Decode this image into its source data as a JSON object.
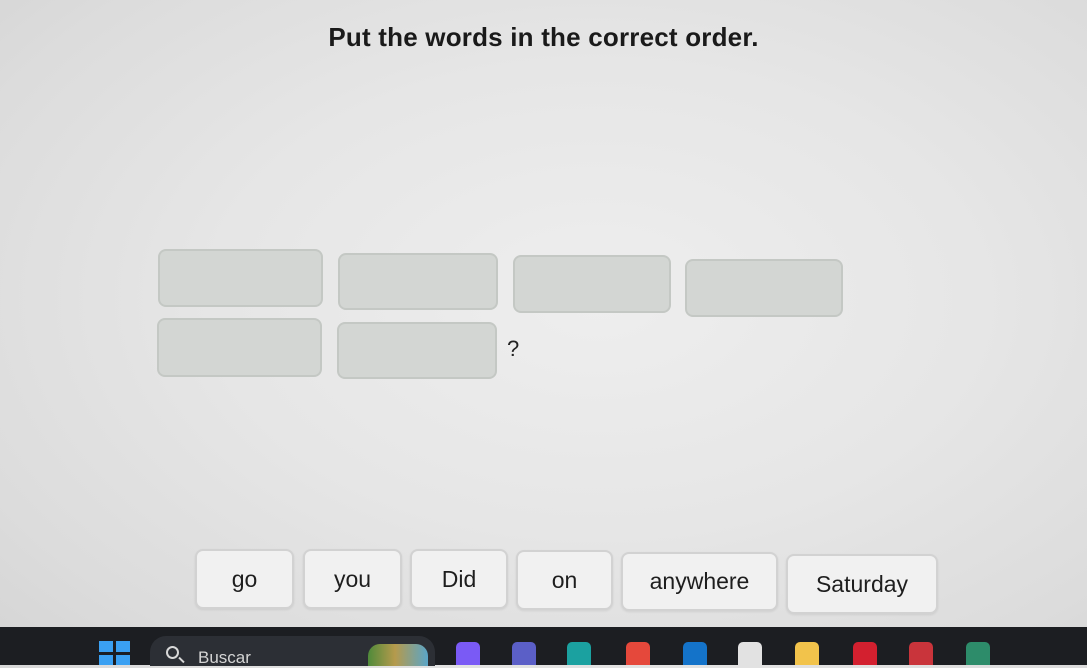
{
  "exercise": {
    "instruction": "Put the words in the correct order.",
    "answer_slots": [
      "",
      "",
      "",
      "",
      "",
      ""
    ],
    "end_punctuation": "?",
    "word_bank": [
      "go",
      "you",
      "Did",
      "on",
      "anywhere",
      "Saturday"
    ]
  },
  "taskbar": {
    "search_label": "Buscar",
    "pinned_apps": [
      {
        "icon": "copilot-icon",
        "color": "#7a5af5"
      },
      {
        "icon": "teams-icon",
        "color": "#5b5fc7"
      },
      {
        "icon": "edge-icon",
        "color": "#1ba1a0"
      },
      {
        "icon": "chrome-icon",
        "color": "#e5483b"
      },
      {
        "icon": "outlook-icon",
        "color": "#1473c9"
      },
      {
        "icon": "store-icon",
        "color": "#e2e2e2"
      },
      {
        "icon": "file-explorer-icon",
        "color": "#f2c34b"
      },
      {
        "icon": "opera-icon",
        "color": "#d3202f"
      },
      {
        "icon": "wps-icon",
        "color": "#c9343b"
      },
      {
        "icon": "profile-app-icon",
        "color": "#2d8c6a"
      }
    ]
  }
}
